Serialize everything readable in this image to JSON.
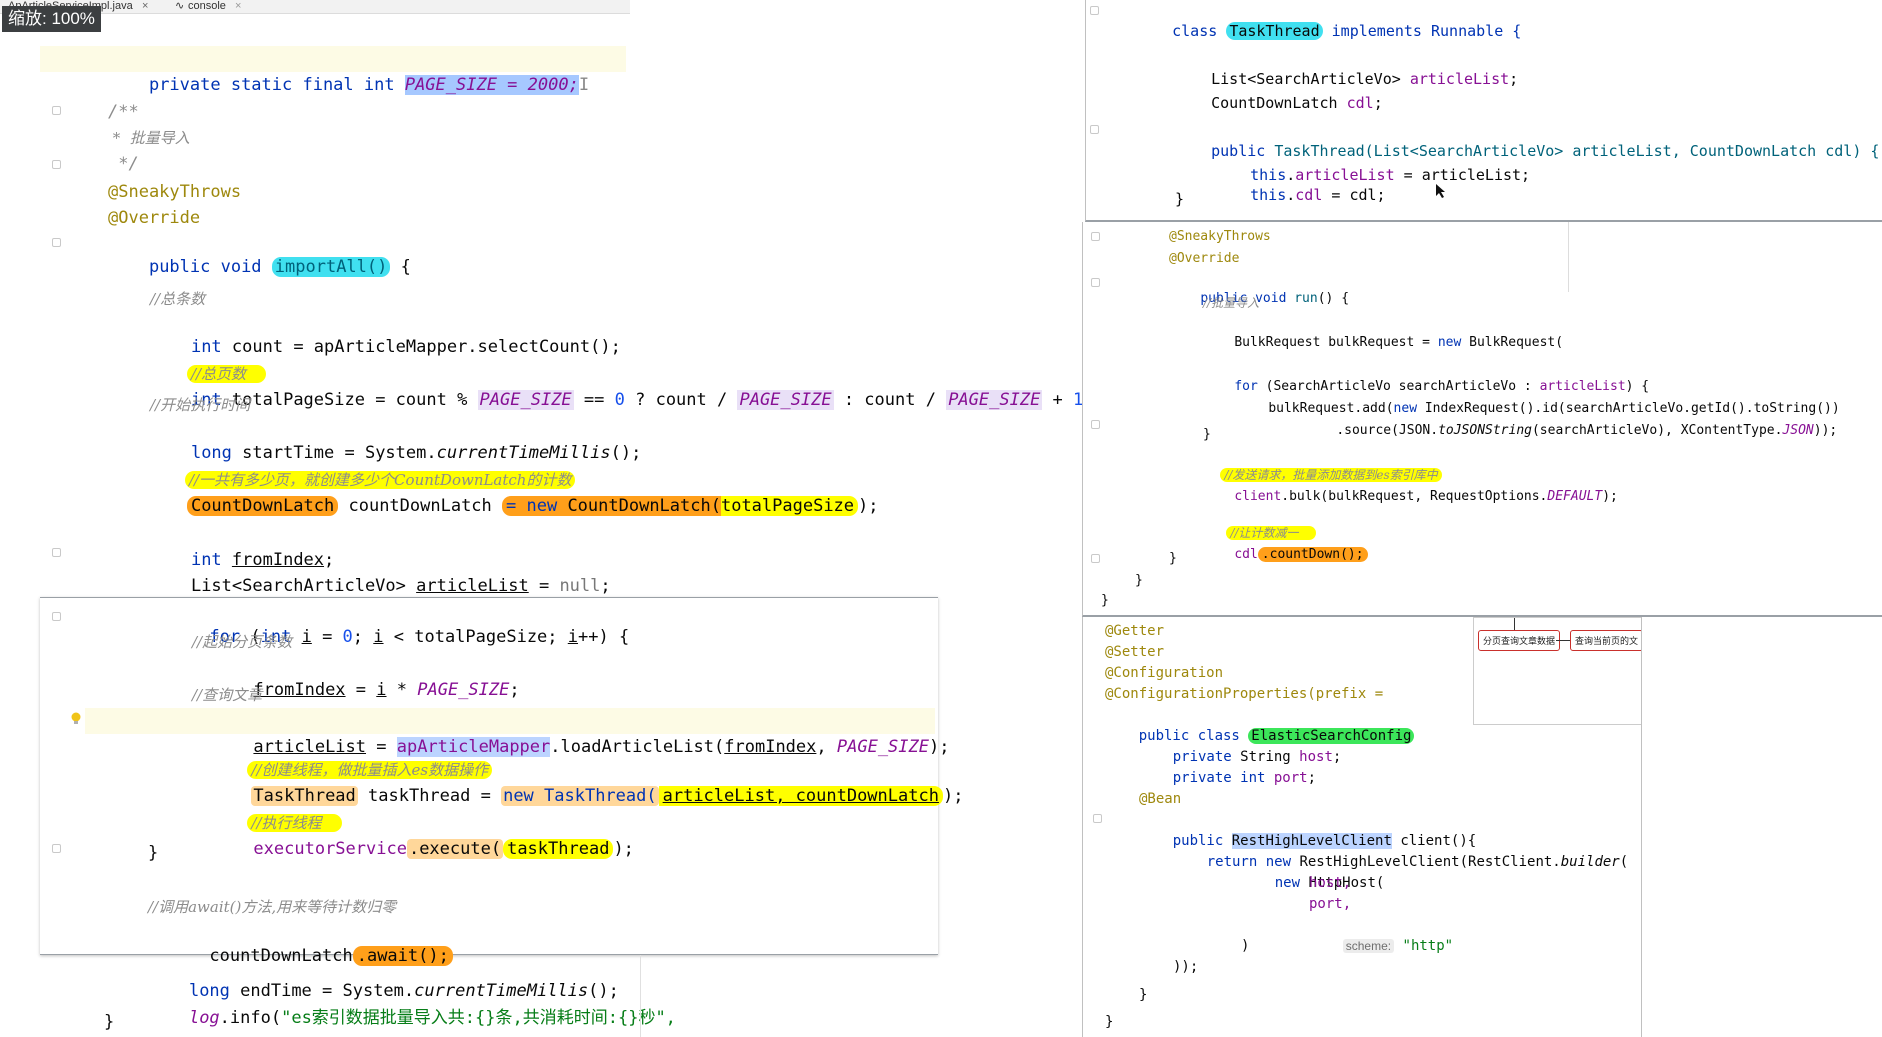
{
  "tabs": [
    {
      "label": "ApArticleServiceImpl.java"
    },
    {
      "label": "console"
    }
  ],
  "zoom_label": "缩放: 100%",
  "left": {
    "page_size_line": [
      "private static final int ",
      "PAGE_SIZE = 2000;"
    ],
    "doc": [
      "/**",
      " *  批量导入",
      " */"
    ],
    "annotations": [
      "@SneakyThrows",
      "@Override"
    ],
    "method_sig": [
      "public void ",
      "importAll()",
      " {"
    ],
    "comment_total": "//总条数",
    "count_line": [
      "int ",
      "count = apArticleMapper.selectCount();"
    ],
    "comment_pages": "//总页数",
    "total_page_line": {
      "p1": "int ",
      "p2": "totalPageSize = count % ",
      "c1": "PAGE_SIZE",
      "p3": " == ",
      "n0": "0",
      "p4": " ? count / ",
      "c2": "PAGE_SIZE",
      "p5": " : count / ",
      "c3": "PAGE_SIZE",
      "p6": " + ",
      "n1": "1",
      "p7": ";"
    },
    "comment_start": "//开始执行时间",
    "start_line": [
      "long ",
      "startTime = System.",
      "currentTimeMillis",
      "();"
    ],
    "comment_latch": "//一共有多少页，就创建多少个CountDownLatch的计数",
    "latch_line": [
      "CountDownLatch",
      " countDownLatch ",
      "= new ",
      "CountDownLatch(",
      "totalPageSize",
      ");"
    ],
    "from_index_line": [
      "int ",
      "fromIndex",
      ";"
    ],
    "article_list_line": [
      "List<SearchArticleVo> ",
      "articleList",
      " = ",
      "null",
      ";"
    ],
    "for_line": [
      "for ",
      "(",
      "int ",
      "i",
      " = ",
      "0",
      "; ",
      "i",
      " < totalPageSize; ",
      "i",
      "++) {"
    ],
    "comment_page_start": "//起始分页条数",
    "from_assign": [
      "fromIndex",
      " = ",
      "i",
      " * ",
      "PAGE_SIZE",
      ";"
    ],
    "comment_query": "//查询文章",
    "article_assign": [
      "articleList",
      " = ",
      "apArticleMapper",
      ".loadArticleList(",
      "fromIndex",
      ", ",
      "PAGE_SIZE",
      ");"
    ],
    "comment_thread": "//创建线程，做批量插入es数据操作",
    "task_line": [
      "TaskThread",
      " taskThread = ",
      "new TaskThread(",
      "articleList, countDownLatch",
      ");"
    ],
    "comment_exec": "//执行线程",
    "exec_line": [
      "executorService",
      ".execute(",
      "taskThread",
      ");"
    ],
    "close_brace": "}",
    "comment_await": "//调用await()方法,用来等待计数归零",
    "await_line": [
      "countDownLatch",
      ".await();"
    ],
    "end_line": [
      "long ",
      "endTime = System.",
      "currentTimeMillis",
      "();"
    ],
    "log_line": [
      "log",
      ".info(",
      "\"es索引数据批量导入共:{}条,共消耗时间:{}秒\","
    ],
    "final_brace": "}"
  },
  "panel_a": {
    "class_line": [
      "class ",
      "TaskThread",
      " implements Runnable {"
    ],
    "f1": [
      "List<SearchArticleVo> ",
      "articleList",
      ";"
    ],
    "f2": [
      "CountDownLatch ",
      "cdl",
      ";"
    ],
    "ctor": [
      "public ",
      "TaskThread(List<SearchArticleVo> articleList, CountDownLatch cdl) {"
    ],
    "a1": [
      "this",
      ".",
      "articleList",
      " = articleList;"
    ],
    "a2": [
      "this",
      ".",
      "cdl",
      " = cdl;"
    ],
    "close": "}"
  },
  "panel_b": {
    "ann1": "@SneakyThrows",
    "ann2": "@Override",
    "run_sig": [
      "public void ",
      "run",
      "() {"
    ],
    "cmt_batch": "//批量导入",
    "bulk_line": [
      "BulkRequest bulkRequest = ",
      "new ",
      "BulkRequest("
    ],
    "for_line": [
      "for ",
      "(SearchArticleVo searchArticleVo : ",
      "articleList",
      ") {"
    ],
    "add_line": [
      "bulkRequest.add(",
      "new ",
      "IndexRequest().id(searchArticleVo.getId().toString())"
    ],
    "source_line": [
      ".source(JSON.",
      "toJSONString",
      "(searchArticleVo), XContentType.",
      "JSON",
      "));"
    ],
    "close_for": "}",
    "cmt_send": "//发送请求，批量添加数据到es索引库中",
    "bulk_send": [
      "client",
      ".bulk(bulkRequest, RequestOptions.",
      "DEFAULT",
      ");"
    ],
    "cmt_count": "//让计数减一",
    "count_down": [
      "cdl",
      ".countDown();"
    ],
    "close1": "}",
    "close2": "}",
    "close3": "}"
  },
  "panel_c": {
    "ann": [
      "@Getter",
      "@Setter",
      "@Configuration",
      "@ConfigurationProperties(prefix ="
    ],
    "class_line": [
      "public class ",
      "ElasticSearchConfig"
    ],
    "f1": [
      "private ",
      "String ",
      "host",
      ";"
    ],
    "f2": [
      "private int ",
      "port",
      ";"
    ],
    "bean": "@Bean",
    "client_sig": [
      "public ",
      "RestHighLevelClient",
      " client(){"
    ],
    "ret_line": [
      "return new ",
      "RestHighLevelClient(RestClient.",
      "builder",
      "("
    ],
    "http_line": [
      "new ",
      "HttpHost("
    ],
    "host": "host,",
    "port": "port,",
    "scheme_hint": "scheme:",
    "scheme_val": "\"http\"",
    "paren": ")",
    "close_paren": "));",
    "close_method": "}",
    "close_class": "}",
    "diagram": {
      "box1": "分页查询文章数据",
      "box2": "查询当前页的文"
    }
  }
}
